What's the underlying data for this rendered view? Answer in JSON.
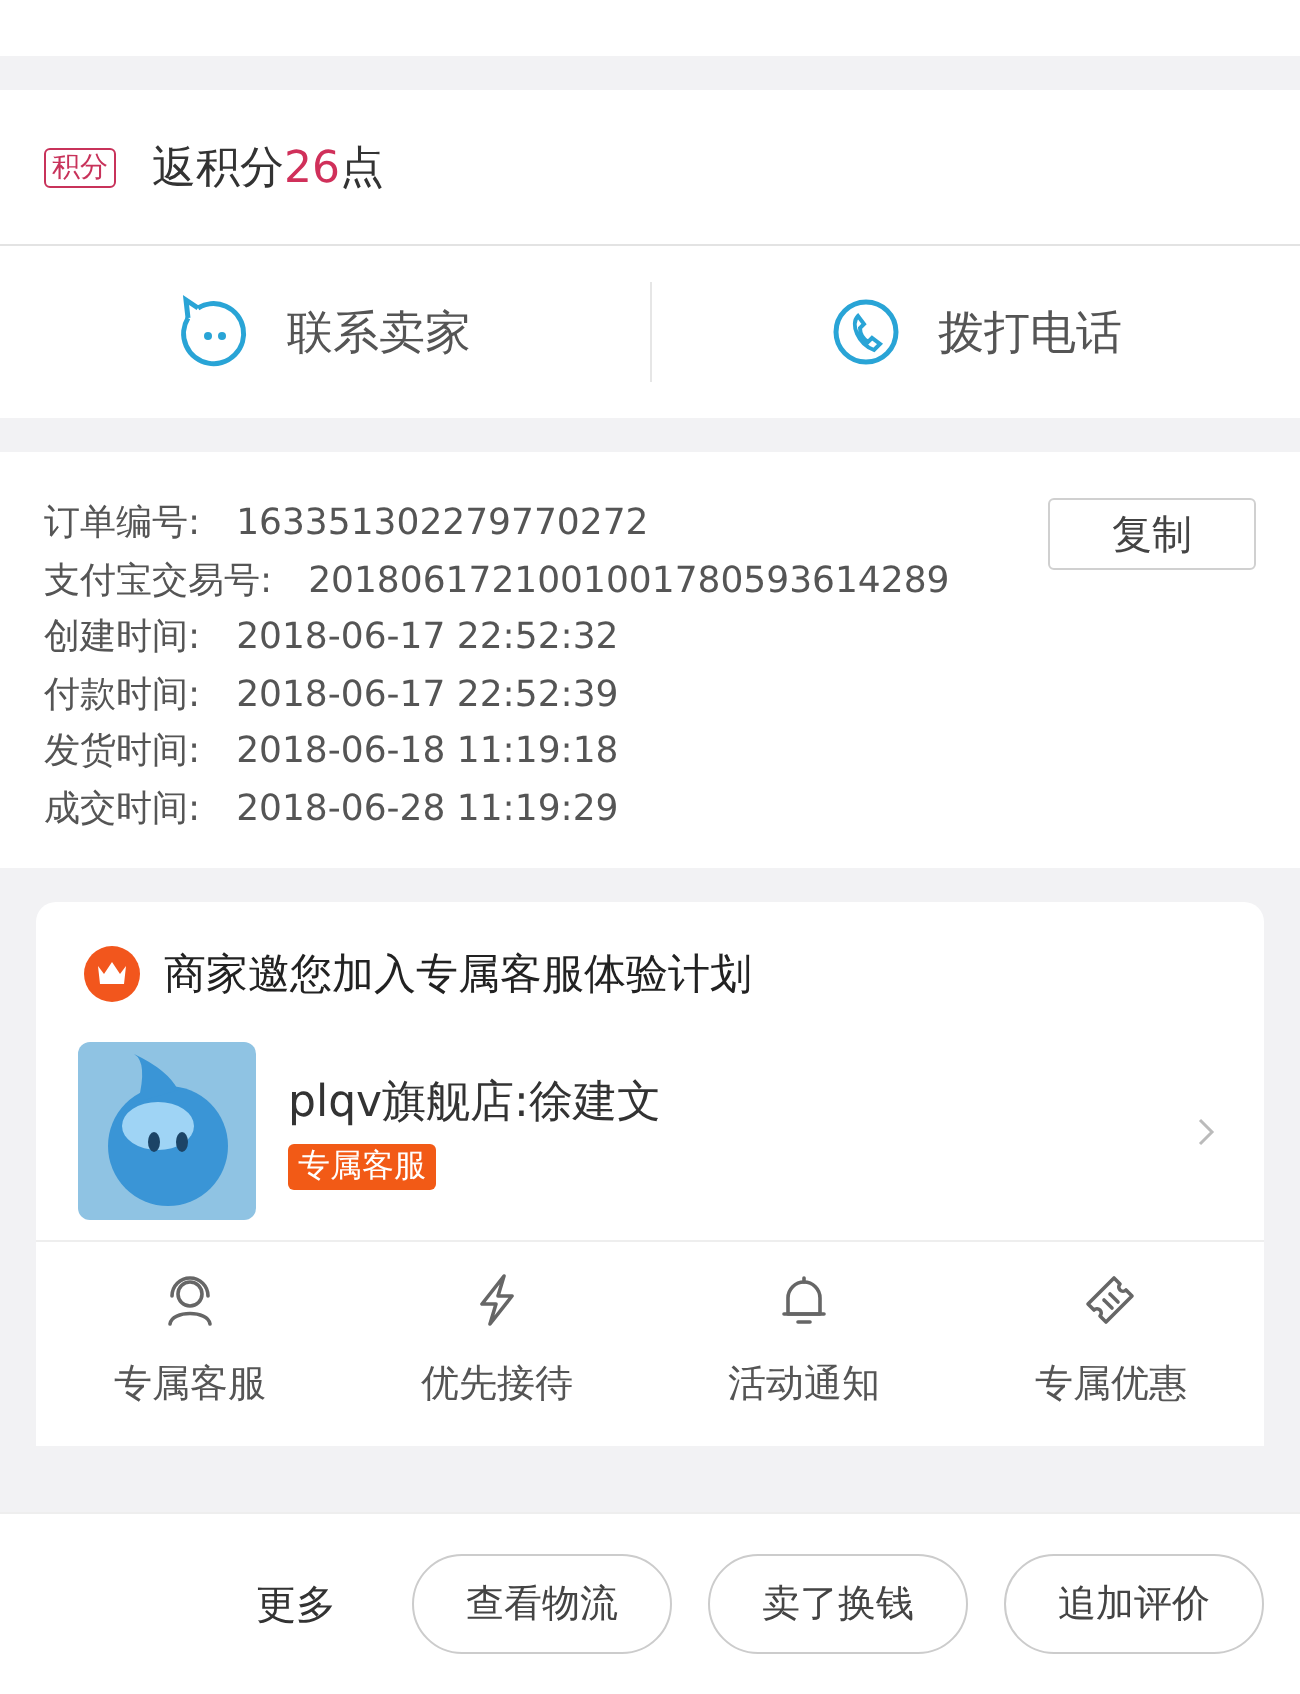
{
  "points": {
    "badge": "积分",
    "prefix": "返积分",
    "amount": "26",
    "suffix": "点"
  },
  "contact": [
    {
      "kind": "chat",
      "label": "联系卖家"
    },
    {
      "kind": "phone",
      "label": "拨打电话"
    }
  ],
  "order_info": {
    "copy_button": "复制",
    "rows": [
      {
        "label": "订单编号:",
        "value": "163351302279770272"
      },
      {
        "label": "支付宝交易号:",
        "value": "2018061721001001780593614289"
      },
      {
        "label": "创建时间:",
        "value": "2018-06-17 22:52:32"
      },
      {
        "label": "付款时间:",
        "value": "2018-06-17 22:52:39"
      },
      {
        "label": "发货时间:",
        "value": "2018-06-18 11:19:18"
      },
      {
        "label": "成交时间:",
        "value": "2018-06-28 11:19:29"
      }
    ]
  },
  "service_card": {
    "title": "商家邀您加入专属客服体验计划",
    "store": {
      "name": "plqv旗舰店:徐建文",
      "tag": "专属客服"
    },
    "benefits": [
      {
        "kind": "agent",
        "label": "专属客服"
      },
      {
        "kind": "bolt",
        "label": "优先接待"
      },
      {
        "kind": "bell",
        "label": "活动通知"
      },
      {
        "kind": "ticket",
        "label": "专属优惠"
      }
    ]
  },
  "bottom_bar": {
    "more": "更多",
    "buttons": [
      "查看物流",
      "卖了换钱",
      "追加评价"
    ]
  }
}
